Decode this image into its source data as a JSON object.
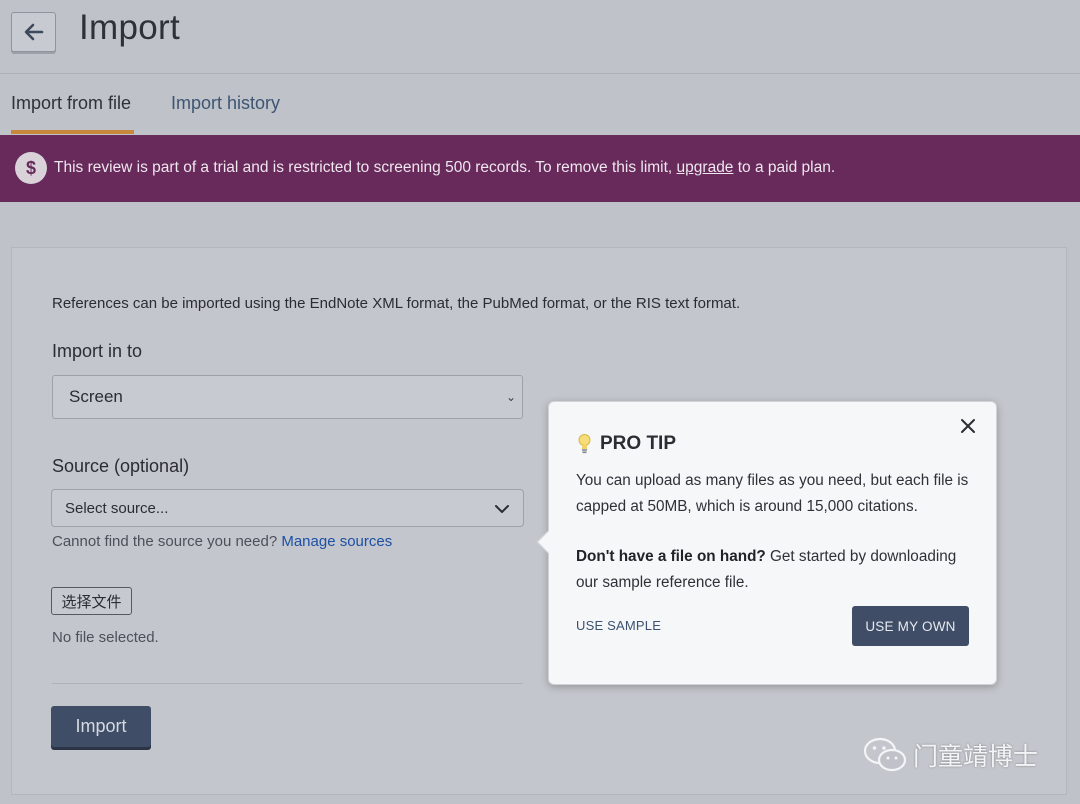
{
  "header": {
    "title": "Import"
  },
  "tabs": [
    {
      "label": "Import from file",
      "active": true
    },
    {
      "label": "Import history",
      "active": false
    }
  ],
  "banner": {
    "icon": "dollar-icon",
    "text_before": "This review is part of a trial and is restricted to screening 500 records. To remove this limit, ",
    "link": "upgrade",
    "text_after": " to a paid plan.",
    "color": "#672a5b"
  },
  "form": {
    "intro": "References can be imported using the EndNote XML format, the PubMed format, or the RIS text format.",
    "import_in_to_label": "Import in to",
    "import_in_to_value": "Screen",
    "source_label": "Source (optional)",
    "source_placeholder": "Select source...",
    "source_hint": "Cannot find the source you need?",
    "manage_sources": "Manage sources",
    "choose_file": "选择文件",
    "no_file": "No file selected.",
    "import_button": "Import"
  },
  "pro_tip": {
    "title": "PRO TIP",
    "p1": "You can upload as many files as you need, but each file is capped at 50MB, which is around 15,000 citations.",
    "p2_bold": "Don't have a file on hand?",
    "p2_rest": " Get started by downloading our sample reference file.",
    "use_sample": "USE SAMPLE",
    "use_own": "USE MY OWN"
  },
  "watermark": {
    "text": "门童靖博士"
  },
  "colors": {
    "accent_tab": "#c7883c",
    "primary_button": "#3f4d66",
    "link": "#1d50a6"
  }
}
